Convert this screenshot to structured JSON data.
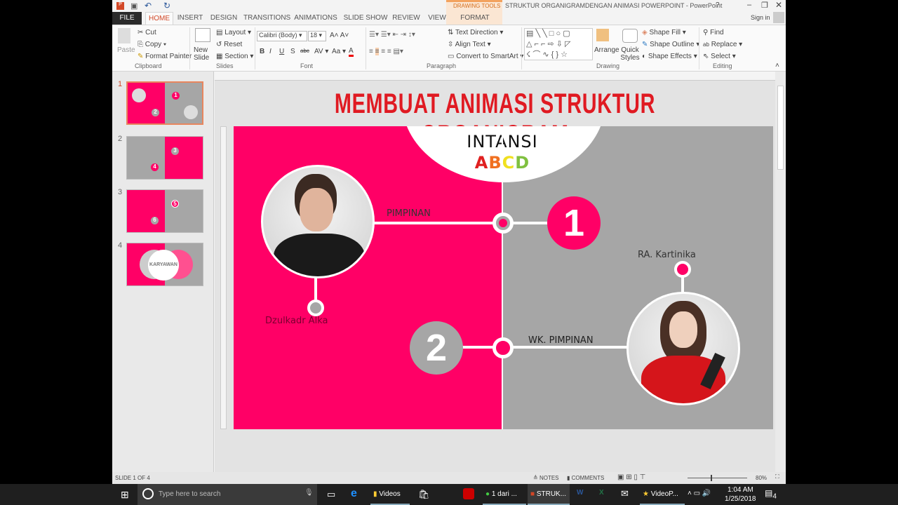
{
  "window": {
    "title": "STRUKTUR ORGANIGRAMDENGAN ANIMASI POWERPOINT - PowerPoint",
    "contextual_tab_group": "DRAWING TOOLS",
    "sign_in": "Sign in",
    "help": "?"
  },
  "tabs": [
    "FILE",
    "HOME",
    "INSERT",
    "DESIGN",
    "TRANSITIONS",
    "ANIMATIONS",
    "SLIDE SHOW",
    "REVIEW",
    "VIEW",
    "FORMAT"
  ],
  "ribbon": {
    "clipboard": {
      "label": "Clipboard",
      "paste": "Paste",
      "cut": "Cut",
      "copy": "Copy",
      "format_painter": "Format Painter"
    },
    "slides": {
      "label": "Slides",
      "new_slide": "New Slide",
      "layout": "Layout",
      "reset": "Reset",
      "section": "Section"
    },
    "font": {
      "label": "Font",
      "font_name": "Calibri (Body)",
      "font_size": "18"
    },
    "paragraph": {
      "label": "Paragraph",
      "text_direction": "Text Direction",
      "align_text": "Align Text",
      "convert_smartart": "Convert to SmartArt"
    },
    "drawing": {
      "label": "Drawing",
      "arrange": "Arrange",
      "quick_styles": "Quick Styles",
      "shape_fill": "Shape Fill",
      "shape_outline": "Shape Outline",
      "shape_effects": "Shape Effects"
    },
    "editing": {
      "label": "Editing",
      "find": "Find",
      "replace": "Replace",
      "select": "Select"
    }
  },
  "thumbnails": [
    {
      "num": "1",
      "labels": [
        "1",
        "2"
      ],
      "selected": true
    },
    {
      "num": "2",
      "labels": [
        "3",
        "4"
      ]
    },
    {
      "num": "3",
      "labels": [
        "5",
        "6"
      ]
    },
    {
      "num": "4",
      "labels": [
        "KARYAWAN"
      ]
    }
  ],
  "slide": {
    "heading": "MEMBUAT ANIMASI STRUKTUR ORGANIGRAM",
    "org_title": "INTANSI",
    "org_letters": [
      {
        "ch": "A",
        "color": "#e02020"
      },
      {
        "ch": "B",
        "color": "#f07020"
      },
      {
        "ch": "C",
        "color": "#f0e020"
      },
      {
        "ch": "D",
        "color": "#80c040"
      }
    ],
    "role1": "PIMPINAN",
    "num1": "1",
    "name1": "Dzulkadr Alka",
    "role2": "WK. PIMPINAN",
    "num2": "2",
    "name2": "RA. Kartinika",
    "colors": {
      "pink": "#ff0066",
      "gray": "#a6a6a6",
      "heading": "#e01a22"
    }
  },
  "status": {
    "slide": "SLIDE 1 OF 4",
    "notes": "NOTES",
    "comments": "COMMENTS",
    "zoom": "80%"
  },
  "taskbar": {
    "search": "Type here to search",
    "apps": [
      "Videos",
      "1 dari ...",
      "STRUK...",
      "VideoP..."
    ],
    "time": "1:04 AM",
    "date": "1/25/2018",
    "notifications": "4"
  }
}
